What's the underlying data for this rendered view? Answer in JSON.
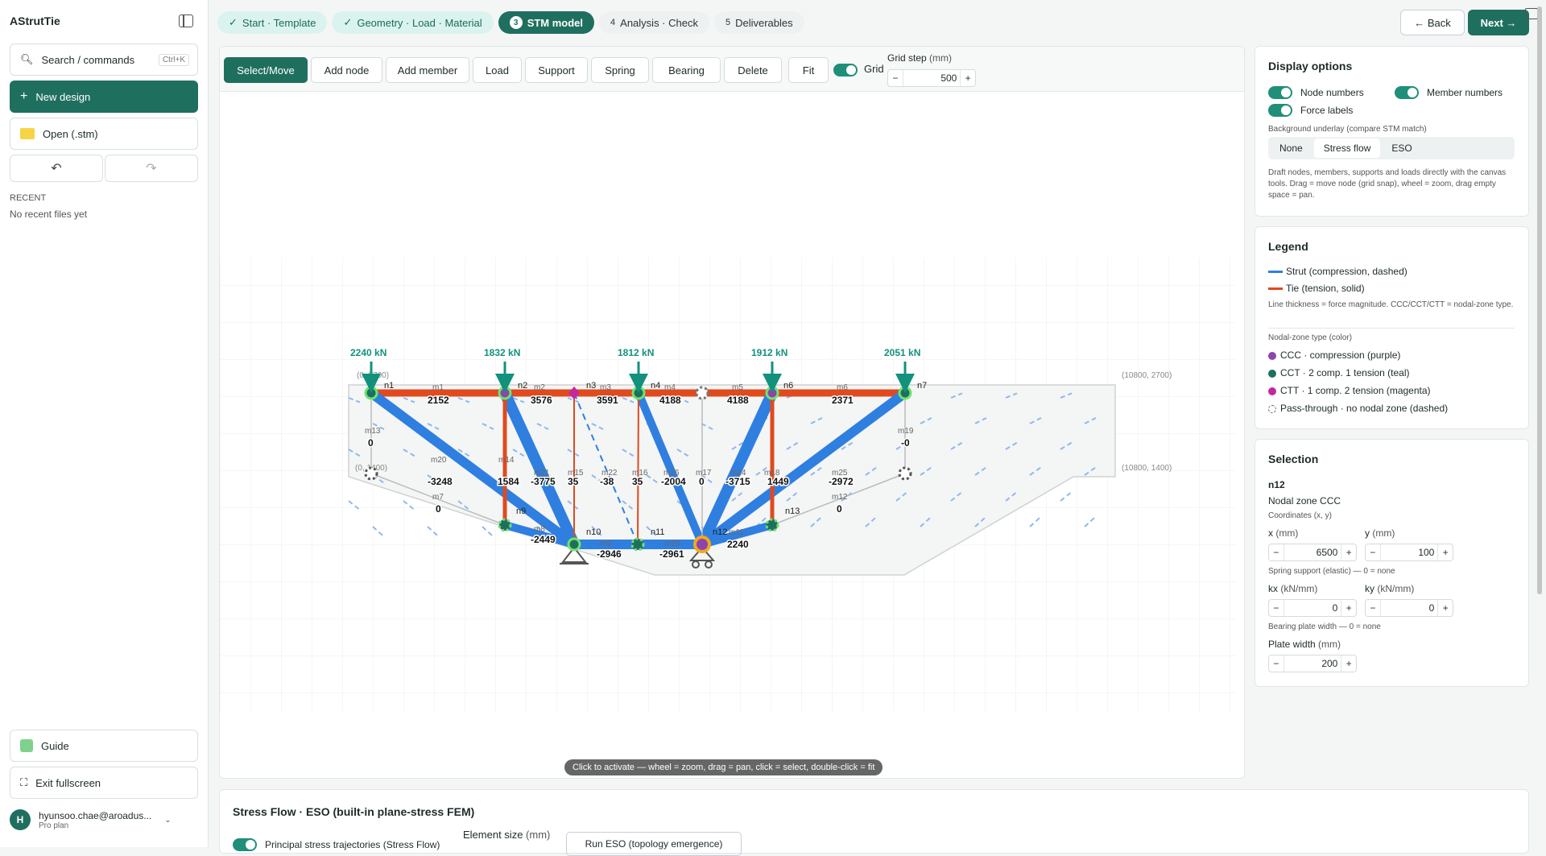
{
  "app": {
    "title": "AStrutTie"
  },
  "sidebar": {
    "search_label": "Search / commands",
    "search_shortcut": "Ctrl+K",
    "new_design": "New design",
    "open": "Open (.stm)",
    "undo": "↶",
    "redo": "↷",
    "recent_title": "RECENT",
    "recent_empty": "No recent files yet",
    "guide": "Guide",
    "exit_fullscreen": "Exit fullscreen",
    "user_name": "hyunsoo.chae@aroadus...",
    "user_plan": "Pro plan",
    "user_initial": "H"
  },
  "steps": [
    {
      "label": "Start · Template",
      "mark": "✓"
    },
    {
      "label": "Geometry · Load · Material",
      "mark": "✓"
    },
    {
      "label": "STM model",
      "mark": "3"
    },
    {
      "label": "Analysis · Check",
      "mark": "4"
    },
    {
      "label": "Deliverables",
      "mark": "5"
    }
  ],
  "nav": {
    "back": "← Back",
    "next": "Next →"
  },
  "toolbar": {
    "tools": [
      "Select/Move",
      "Add node",
      "Add member",
      "Load",
      "Support",
      "Spring",
      "Bearing",
      "Delete"
    ],
    "fit": "Fit",
    "grid_label": "Grid",
    "grid_step_label": "Grid step",
    "grid_step_unit": "(mm)",
    "grid_step_value": "500",
    "minus": "−",
    "plus": "+"
  },
  "canvas": {
    "hint": "Click to activate — wheel = zoom, drag = pan, click = select, double-click = fit",
    "coord_tl": "(0, 2700)",
    "coord_tr": "(10800, 2700)",
    "coord_ml": "(0, 1400)",
    "coord_mr": "(10800, 1400)",
    "loads": [
      "2240 kN",
      "1832 kN",
      "1812 kN",
      "1912 kN",
      "2051 kN"
    ],
    "nodes": [
      "n1",
      "n2",
      "n3",
      "n4",
      "n6",
      "n7",
      "n9",
      "n10",
      "n11",
      "n12",
      "n13"
    ],
    "members": [
      "m1",
      "m2",
      "m3",
      "m4",
      "m5",
      "m6",
      "m13",
      "m20",
      "m14",
      "m21",
      "m15",
      "m22",
      "m16",
      "m26",
      "m17",
      "m24",
      "m18",
      "m25",
      "m19",
      "m7",
      "m8",
      "m9",
      "m10",
      "m11",
      "m12"
    ],
    "forces": [
      "2152",
      "3576",
      "3591",
      "4188",
      "4188",
      "2371",
      "0",
      "-3248",
      "1584",
      "-3775",
      "35",
      "-38",
      "35",
      "-2004",
      "0",
      "-3715",
      "1449",
      "-2972",
      "-0",
      "0",
      "-2449",
      "-2946",
      "-2961",
      "2240",
      "0"
    ]
  },
  "display": {
    "title": "Display options",
    "node_numbers": "Node numbers",
    "member_numbers": "Member numbers",
    "force_labels": "Force labels",
    "bg_label": "Background underlay (compare STM match)",
    "bg_options": [
      "None",
      "Stress flow",
      "ESO"
    ],
    "bg_selected": "Stress flow",
    "help": "Draft nodes, members, supports and loads directly with the canvas tools. Drag = move node (grid snap), wheel = zoom, drag empty space = pan."
  },
  "legend": {
    "title": "Legend",
    "strut": "Strut (compression, dashed)",
    "tie": "Tie (tension, solid)",
    "thickness_note": "Line thickness = force magnitude. CCC/CCT/CTT = nodal-zone type.",
    "nodal_title": "Nodal-zone type (color)",
    "ccc": "CCC · compression (purple)",
    "cct": "CCT · 2 comp. 1 tension (teal)",
    "ctt": "CTT · 1 comp. 2 tension (magenta)",
    "pass": "Pass-through · no nodal zone (dashed)"
  },
  "selection": {
    "title": "Selection",
    "node": "n12",
    "zone": "Nodal zone CCC",
    "coords_label": "Coordinates (x, y)",
    "x_label": "x",
    "x_unit": "(mm)",
    "y_label": "y",
    "y_unit": "(mm)",
    "x": "6500",
    "y": "100",
    "spring_label": "Spring support (elastic) — 0 = none",
    "kx_label": "kx",
    "kx_unit": "(kN/mm)",
    "ky_label": "ky",
    "ky_unit": "(kN/mm)",
    "kx": "0",
    "ky": "0",
    "bearing_label": "Bearing plate width — 0 = none",
    "plate_label": "Plate width",
    "plate_unit": "(mm)",
    "plate": "200"
  },
  "bottom": {
    "title": "Stress Flow · ESO (built-in plane-stress FEM)",
    "trajectories": "Principal stress trajectories (Stress Flow)",
    "element_size": "Element size",
    "element_unit": "(mm)",
    "run_eso": "Run ESO (topology emergence)"
  },
  "colors": {
    "accent": "#1f6f5f",
    "strut": "#2f7fe0",
    "tie": "#e04a1e",
    "ccc": "#8e44ad",
    "cct": "#1f6f5f",
    "ctt": "#c2299e",
    "load": "#12917c"
  }
}
